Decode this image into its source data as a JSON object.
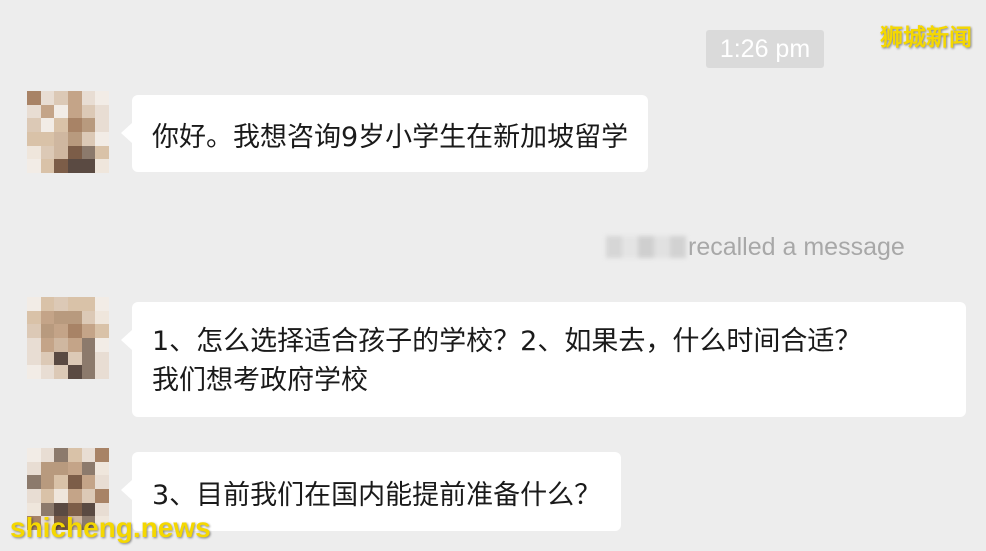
{
  "chat": {
    "timestamp": "1:26 pm",
    "recall_text": "recalled a message",
    "messages": [
      {
        "lines": [
          "你好。我想咨询9岁小学生在新加坡留学"
        ]
      },
      {
        "lines": [
          "1、怎么选择适合孩子的学校？2、如果去，什么时间合适？",
          "我们想考政府学校"
        ]
      },
      {
        "lines": [
          "3、目前我们在国内能提前准备什么？"
        ]
      }
    ]
  },
  "watermarks": {
    "top_right": "狮城新闻",
    "bottom_left": "shicheng.news"
  },
  "colors": {
    "background": "#ededed",
    "bubble": "#ffffff",
    "timestamp_bg": "#dadada",
    "system_text": "#a8a8a8",
    "watermark": "#f5d800"
  },
  "icons": {
    "avatar": "pixelated-avatar-image"
  }
}
